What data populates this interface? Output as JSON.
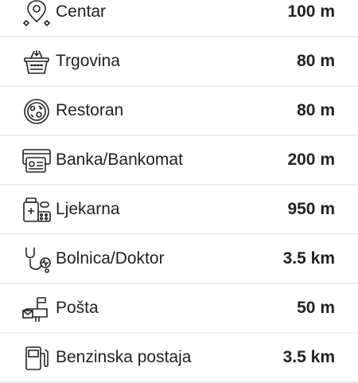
{
  "amenities": [
    {
      "label": "Centar",
      "distance": "100 m",
      "icon": "location-pin-icon"
    },
    {
      "label": "Trgovina",
      "distance": "80 m",
      "icon": "shopping-basket-icon"
    },
    {
      "label": "Restoran",
      "distance": "80 m",
      "icon": "restaurant-plate-icon"
    },
    {
      "label": "Banka/Bankomat",
      "distance": "200 m",
      "icon": "bank-card-atm-icon"
    },
    {
      "label": "Ljekarna",
      "distance": "950 m",
      "icon": "pharmacy-pills-icon"
    },
    {
      "label": "Bolnica/Doktor",
      "distance": "3.5 km",
      "icon": "stethoscope-icon"
    },
    {
      "label": "Pošta",
      "distance": "50 m",
      "icon": "mailbox-icon"
    },
    {
      "label": "Benzinska postaja",
      "distance": "3.5 km",
      "icon": "fuel-pump-icon"
    }
  ]
}
